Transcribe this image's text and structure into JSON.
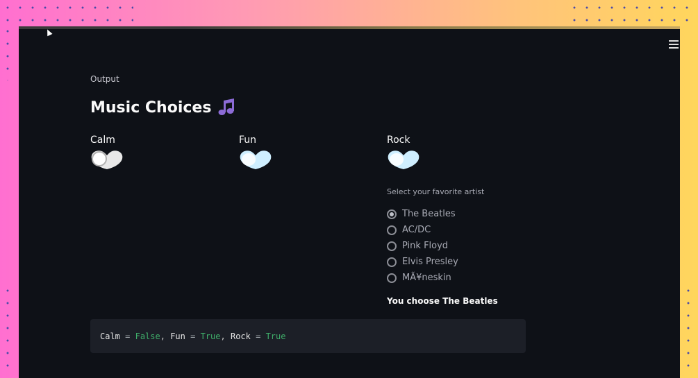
{
  "output_label": "Output",
  "title": "Music Choices",
  "title_icon": "music-note-icon",
  "toggles": [
    {
      "label": "Calm",
      "value": false
    },
    {
      "label": "Fun",
      "value": true
    },
    {
      "label": "Rock",
      "value": true
    }
  ],
  "artist_select": {
    "title": "Select your favorite artist",
    "options": [
      "The Beatles",
      "AC/DC",
      "Pink Floyd",
      "Elvis Presley",
      "MÃ¥neskin"
    ],
    "selected": "The Beatles"
  },
  "result_text": "You choose The Beatles",
  "code_output": {
    "calm_name": "Calm",
    "calm_value": "False",
    "fun_name": "Fun",
    "fun_value": "True",
    "rock_name": "Rock",
    "rock_value": "True",
    "eq": "=",
    "sep": ","
  },
  "colors": {
    "app_bg": "#0e1117",
    "code_bg": "#1c1f27",
    "bool_color": "#3fae6a",
    "toggle_on": "#cfefff",
    "toggle_off": "#e8e8e8",
    "note_purple": "#8c6bd6"
  }
}
